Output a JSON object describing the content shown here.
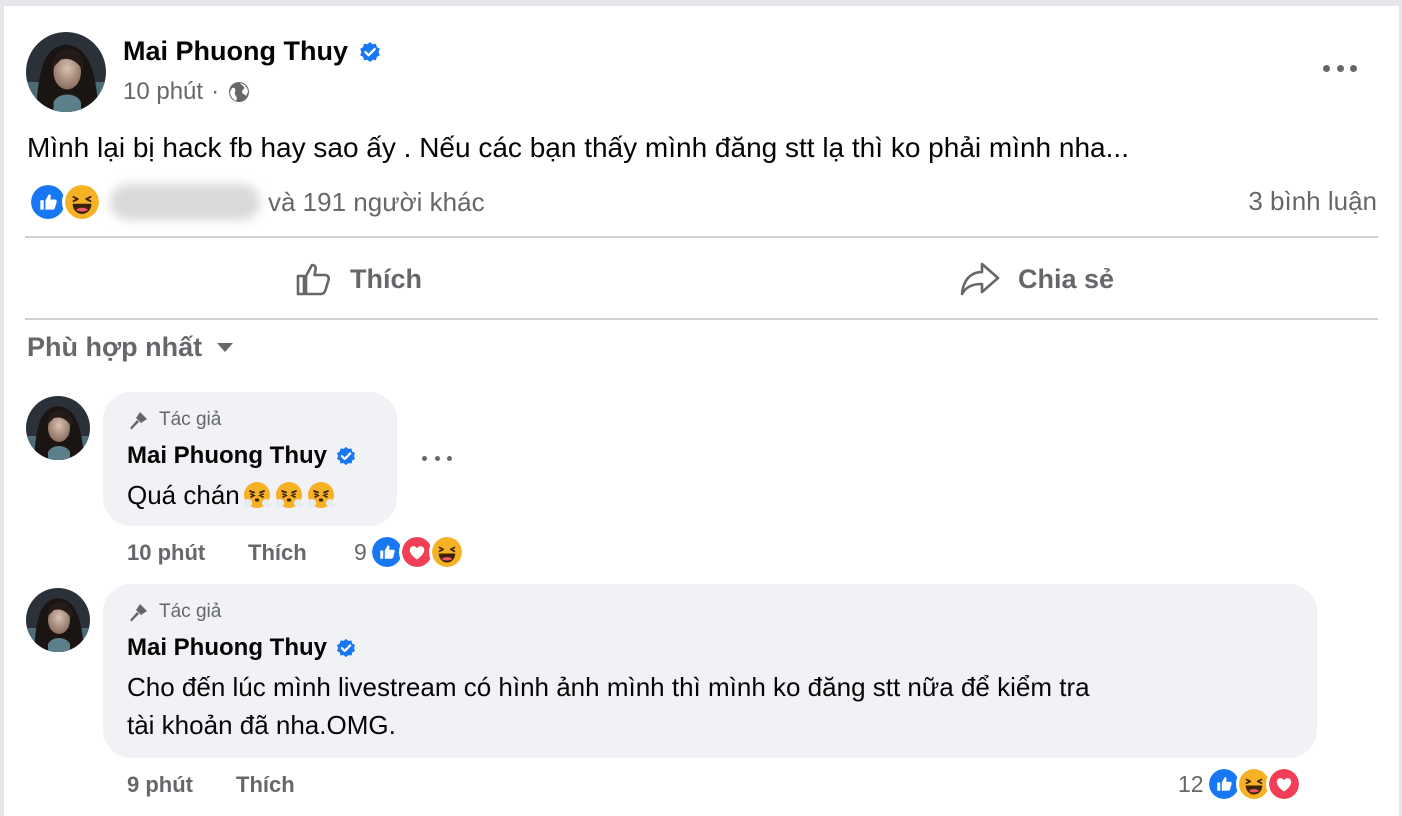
{
  "post": {
    "author": "Mai Phuong Thuy",
    "time": "10 phút",
    "separator": "·",
    "privacy_icon": "globe-icon",
    "text": "Mình lại bị hack fb hay sao ấy . Nếu các bạn thấy mình đăng stt lạ thì ko phải mình nha...",
    "reactions": [
      "like",
      "haha"
    ],
    "reactions_text": "và 191 người khác",
    "comment_count": "3 bình luận"
  },
  "actions": {
    "like_label": "Thích",
    "share_label": "Chia sẻ"
  },
  "sort": {
    "label": "Phù hợp nhất"
  },
  "comments": [
    {
      "badge": "Tác giả",
      "author": "Mai Phuong Thuy",
      "text": "Quá chán",
      "emoji": [
        "face-with-steam-icon",
        "face-with-steam-icon",
        "face-with-steam-icon"
      ],
      "time": "10 phút",
      "like_label": "Thích",
      "reaction_count": "9",
      "reactions": [
        "like",
        "love",
        "haha"
      ]
    },
    {
      "badge": "Tác giả",
      "author": "Mai Phuong Thuy",
      "text_line1": "Cho đến lúc mình livestream có hình ảnh mình thì mình ko đăng stt nữa để kiểm tra",
      "text_line2": "tài khoản đã nha.OMG.",
      "time": "9 phút",
      "like_label": "Thích",
      "reaction_count": "12",
      "reactions": [
        "like",
        "haha",
        "love"
      ]
    }
  ],
  "colors": {
    "facebook_blue": "#1877f2",
    "love_red": "#f33e58",
    "haha_yellow": "#f7b125",
    "secondary_text": "#65676b",
    "bubble_bg": "#f0f2f5"
  }
}
